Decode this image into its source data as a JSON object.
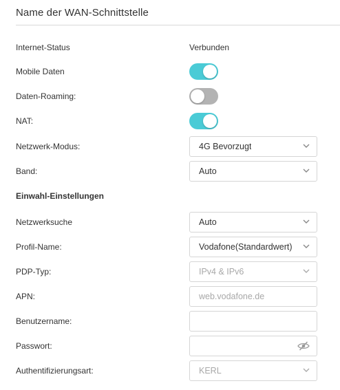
{
  "section": {
    "title": "Name der WAN-Schnittstelle"
  },
  "rows": {
    "internet_status": {
      "label": "Internet-Status",
      "value": "Verbunden"
    },
    "mobile_data": {
      "label": "Mobile Daten",
      "state": "on"
    },
    "roaming": {
      "label": "Daten-Roaming:",
      "state": "off"
    },
    "nat": {
      "label": "NAT:",
      "state": "on"
    },
    "network_mode": {
      "label": "Netzwerk-Modus:",
      "value": "4G Bevorzugt"
    },
    "band": {
      "label": "Band:",
      "value": "Auto"
    }
  },
  "dial_settings": {
    "heading": "Einwahl-Einstellungen",
    "network_search": {
      "label": "Netzwerksuche",
      "value": "Auto"
    },
    "profile_name": {
      "label": "Profil-Name:",
      "value": "Vodafone(Standardwert)"
    },
    "pdp_type": {
      "label": "PDP-Typ:",
      "value": "IPv4 & IPv6"
    },
    "apn": {
      "label": "APN:",
      "value": "web.vodafone.de"
    },
    "username": {
      "label": "Benutzername:",
      "value": ""
    },
    "password": {
      "label": "Passwort:",
      "value": "",
      "icon": "eye-off-icon"
    },
    "auth_type": {
      "label": "Authentifizierungsart:",
      "value": "KERL"
    }
  },
  "colors": {
    "toggle_on": "#4acbd6",
    "toggle_off": "#b3b3b3",
    "border": "#d5d5d5",
    "disabled_text": "#a8a8a8"
  }
}
